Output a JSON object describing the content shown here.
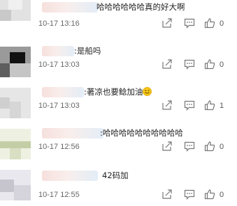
{
  "comments": [
    {
      "text": "哈哈哈哈哈哈真的好大啊",
      "time": "10-17 13:16",
      "likes": "0",
      "avatar_colors": [
        "#d8d8d8",
        "#ececec",
        "#bdbdbd"
      ]
    },
    {
      "text": ":是船吗",
      "time": "10-17 13:03",
      "likes": "0",
      "avatar_colors": [
        "#1a1a1a",
        "#9a9a9a",
        "#5a5a5a"
      ]
    },
    {
      "text": ":著凉也要鲶加油",
      "time": "10-17 13:03",
      "likes": "1",
      "avatar_colors": [
        "#dcdcdc",
        "#c8c8c8",
        "#efefef"
      ]
    },
    {
      "text": ":哈哈哈哈哈哈哈哈哈哈",
      "time": "10-17 12:56",
      "likes": "0",
      "avatar_colors": [
        "#d8e0c4",
        "#bcc7a0",
        "#eef1e2"
      ]
    },
    {
      "text": "42码加",
      "time": "10-17 12:55",
      "likes": "0",
      "avatar_colors": [
        "#d7d6de",
        "#bebdc6",
        "#e9e8ee"
      ]
    }
  ],
  "icons": {
    "share": "share-icon",
    "comment": "comment-icon",
    "like": "thumbs-up-icon",
    "emoji": "smile-emoji-icon"
  },
  "colors": {
    "text": "#222222",
    "time": "#666666",
    "icon": "#777777",
    "emoji": "#f5c518"
  }
}
